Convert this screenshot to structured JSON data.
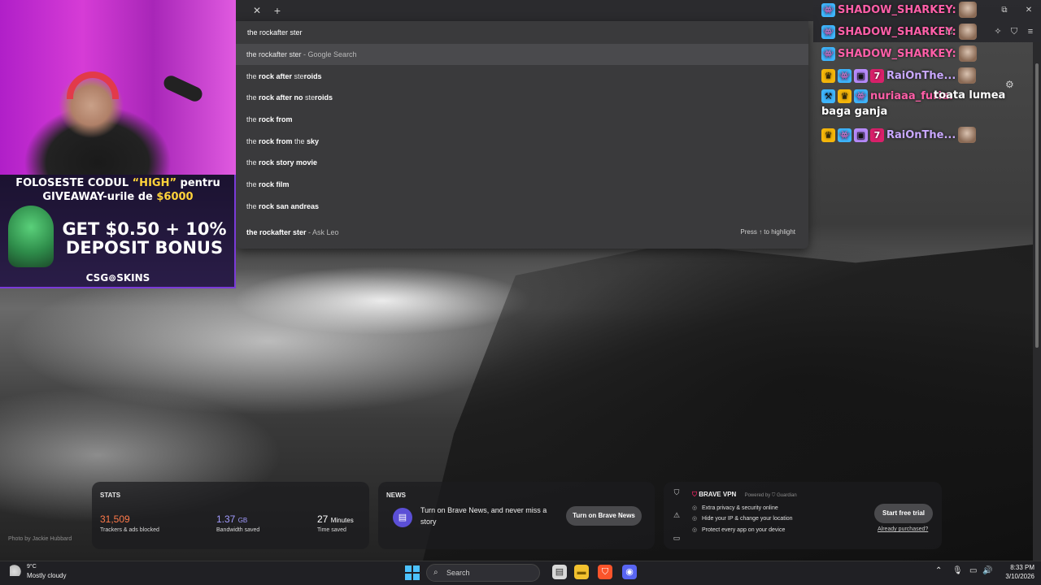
{
  "browser": {
    "tab_close_glyph": "✕",
    "new_tab_glyph": "+",
    "window_controls": [
      "⧉",
      "✕"
    ],
    "toolbar_icons": [
      "bookmarks-icon",
      "extensions-icon",
      "sidebar-icon",
      "leo-icon",
      "shield-icon",
      "menu-icon"
    ]
  },
  "omnibox": {
    "query": "the rockafter ster",
    "suggestions": [
      {
        "prefix": "the rockafter ster",
        "bold": "",
        "rest": "",
        "suffix": " - Google Search"
      },
      {
        "prefix": "the ",
        "bold": "rock after ",
        "rest": "ste",
        "bold2": "roids",
        "suffix": ""
      },
      {
        "prefix": "the ",
        "bold": "rock after no ",
        "rest": "ste",
        "bold2": "roids",
        "suffix": ""
      },
      {
        "prefix": "the ",
        "bold": "rock from",
        "rest": "",
        "bold2": "",
        "suffix": ""
      },
      {
        "prefix": "the ",
        "bold": "rock from ",
        "rest": "the ",
        "bold2": "sky",
        "suffix": ""
      },
      {
        "prefix": "the ",
        "bold": "rock story movie",
        "rest": "",
        "bold2": "",
        "suffix": ""
      },
      {
        "prefix": "the ",
        "bold": "rock film",
        "rest": "",
        "bold2": "",
        "suffix": ""
      },
      {
        "prefix": "the ",
        "bold": "rock san andreas",
        "rest": "",
        "bold2": "",
        "suffix": ""
      },
      {
        "prefix": "the rockafter ster",
        "bold": "",
        "rest": "",
        "bold2": "",
        "suffix": " - Ask Leo"
      }
    ],
    "hint": "Press ↑ to highlight"
  },
  "promo": {
    "line1_pre": "FOLOSESTE CODUL ",
    "line1_code": "“HIGH”",
    "line1_post": " pentru",
    "line2_pre": "GIVEAWAY-urile de ",
    "line2_amount": "$6000",
    "big1": "GET $0.50 + 10%",
    "big2": "DEPOSIT BONUS",
    "brand": "CSG⊚SKINS"
  },
  "chat": {
    "messages": [
      {
        "user": "SHADOW_SHARKEY:",
        "color": "#ff5fa8",
        "text": ""
      },
      {
        "user": "SHADOW_SHARKEY:",
        "color": "#ff5fa8",
        "text": ""
      },
      {
        "user": "SHADOW_SHARKEY:",
        "color": "#ff5fa8",
        "text": ""
      },
      {
        "user": "RaiOnThe...",
        "color": "#c9a8ff",
        "text": ""
      },
      {
        "user": "nuriaaa_furia:",
        "color": "#ff5fa8",
        "text": "toata lumea baga ganja"
      },
      {
        "user": "RaiOnThe...",
        "color": "#c9a8ff",
        "text": ""
      }
    ]
  },
  "stats": {
    "title": "STATS",
    "trackers_value": "31,509",
    "trackers_label": "Trackers & ads blocked",
    "bandwidth_value": "1.37",
    "bandwidth_unit": "GB",
    "bandwidth_label": "Bandwidth saved",
    "time_value": "27",
    "time_unit": "Minutes",
    "time_label": "Time saved",
    "trackers_color": "#ff7a4a",
    "bandwidth_color": "#a29bff"
  },
  "news": {
    "title": "NEWS",
    "text": "Turn on Brave News, and never miss a story",
    "button": "Turn on Brave News"
  },
  "vpn": {
    "title": "BRAVE VPN",
    "powered": "Powered by ⛉ Guardian",
    "features": [
      "Extra privacy & security online",
      "Hide your IP & change your location",
      "Protect every app on your device"
    ],
    "button": "Start free trial",
    "link": "Already purchased?"
  },
  "photo_credit": "Photo by Jackie Hubbard",
  "taskbar": {
    "weather_temp": "9°C",
    "weather_desc": "Mostly cloudy",
    "search_placeholder": "Search",
    "time": "8:33 PM",
    "date": "3/10/2026"
  }
}
